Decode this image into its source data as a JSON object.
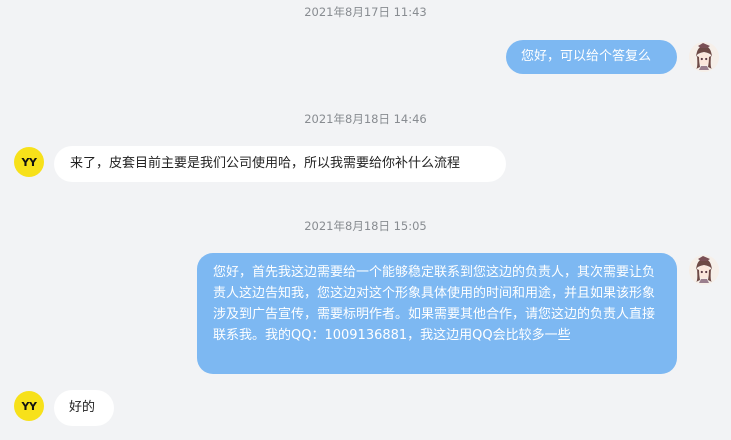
{
  "messages": [
    {
      "type": "timestamp",
      "text": "2021年8月17日 11:43"
    },
    {
      "type": "outgoing",
      "text": "您好，可以给个答复么"
    },
    {
      "type": "timestamp",
      "text": "2021年8月18日 14:46"
    },
    {
      "type": "incoming",
      "text": "来了，皮套目前主要是我们公司使用哈，所以我需要给你补什么流程"
    },
    {
      "type": "timestamp",
      "text": "2021年8月18日 15:05"
    },
    {
      "type": "outgoing",
      "text": "您好，首先我这边需要给一个能够稳定联系到您这边的负责人，其次需要让负责人这边告知我，您这边对这个形象具体使用的时间和用途，并且如果该形象涉及到广告宣传，需要标明作者。如果需要其他合作，请您这边的负责人直接联系我。我的QQ：1009136881，我这边用QQ会比较多一些"
    },
    {
      "type": "incoming",
      "text": "好的"
    }
  ],
  "contact_avatar": {
    "label": "YY",
    "color": "#f7e11a",
    "icon": "yy-logo-icon"
  },
  "self_avatar": {
    "icon": "anime-girl-avatar-icon"
  },
  "colors": {
    "background": "#f2f3f5",
    "outgoing_bubble": "#7db8f2",
    "incoming_bubble": "#ffffff",
    "timestamp": "#888c91"
  }
}
